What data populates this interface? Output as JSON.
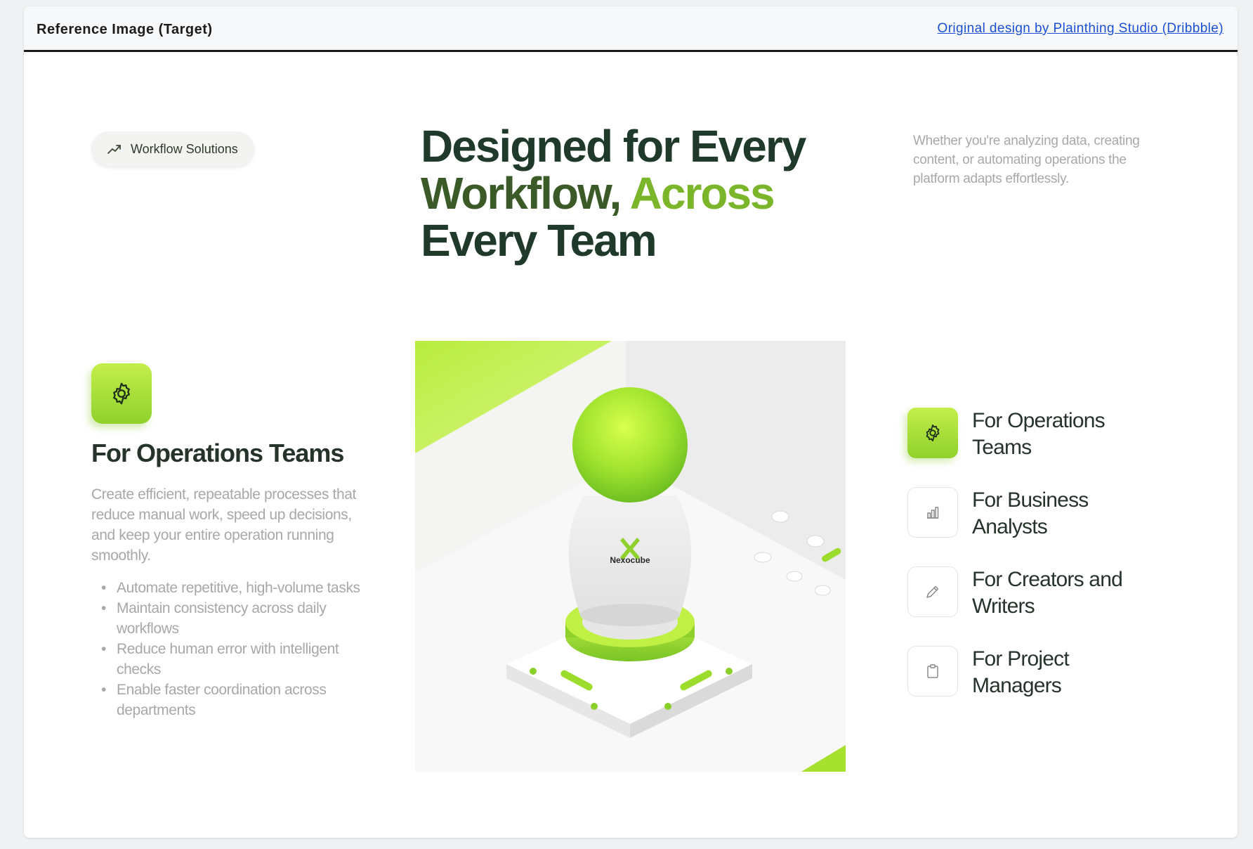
{
  "frame": {
    "title": "Reference Image (Target)",
    "link": "Original design by Plainthing Studio (Dribbble)"
  },
  "badge": {
    "label": "Workflow Solutions",
    "icon": "trend-arrow-icon"
  },
  "headline": {
    "line1": "Designed for Every",
    "line2a": "Workflow,",
    "line2b": "Across",
    "line3": "Every Team"
  },
  "intro": "Whether you're analyzing data, creating content, or automating operations the platform adapts effortlessly.",
  "feature": {
    "icon": "gear-icon",
    "title": "For Operations Teams",
    "description": "Create efficient, repeatable processes that reduce manual work, speed up decisions, and keep your entire operation running smoothly.",
    "bullets": [
      "Automate repetitive, high-volume tasks",
      "Maintain consistency across daily workflows",
      "Reduce human error with intelligent checks",
      "Enable faster coordination across departments"
    ]
  },
  "illustration": {
    "brand": "Nexocube"
  },
  "tabs": [
    {
      "label": "For Operations Teams",
      "icon": "gear-icon",
      "active": true
    },
    {
      "label": "For Business Analysts",
      "icon": "bar-chart-icon",
      "active": false
    },
    {
      "label": "For Creators and Writers",
      "icon": "pencil-icon",
      "active": false
    },
    {
      "label": "For Project Managers",
      "icon": "clipboard-icon",
      "active": false
    }
  ],
  "colors": {
    "accent": "#8fd12c",
    "accent_light": "#c4ee4b",
    "heading": "#1f3a2a",
    "muted_text": "#a7a9a6"
  }
}
